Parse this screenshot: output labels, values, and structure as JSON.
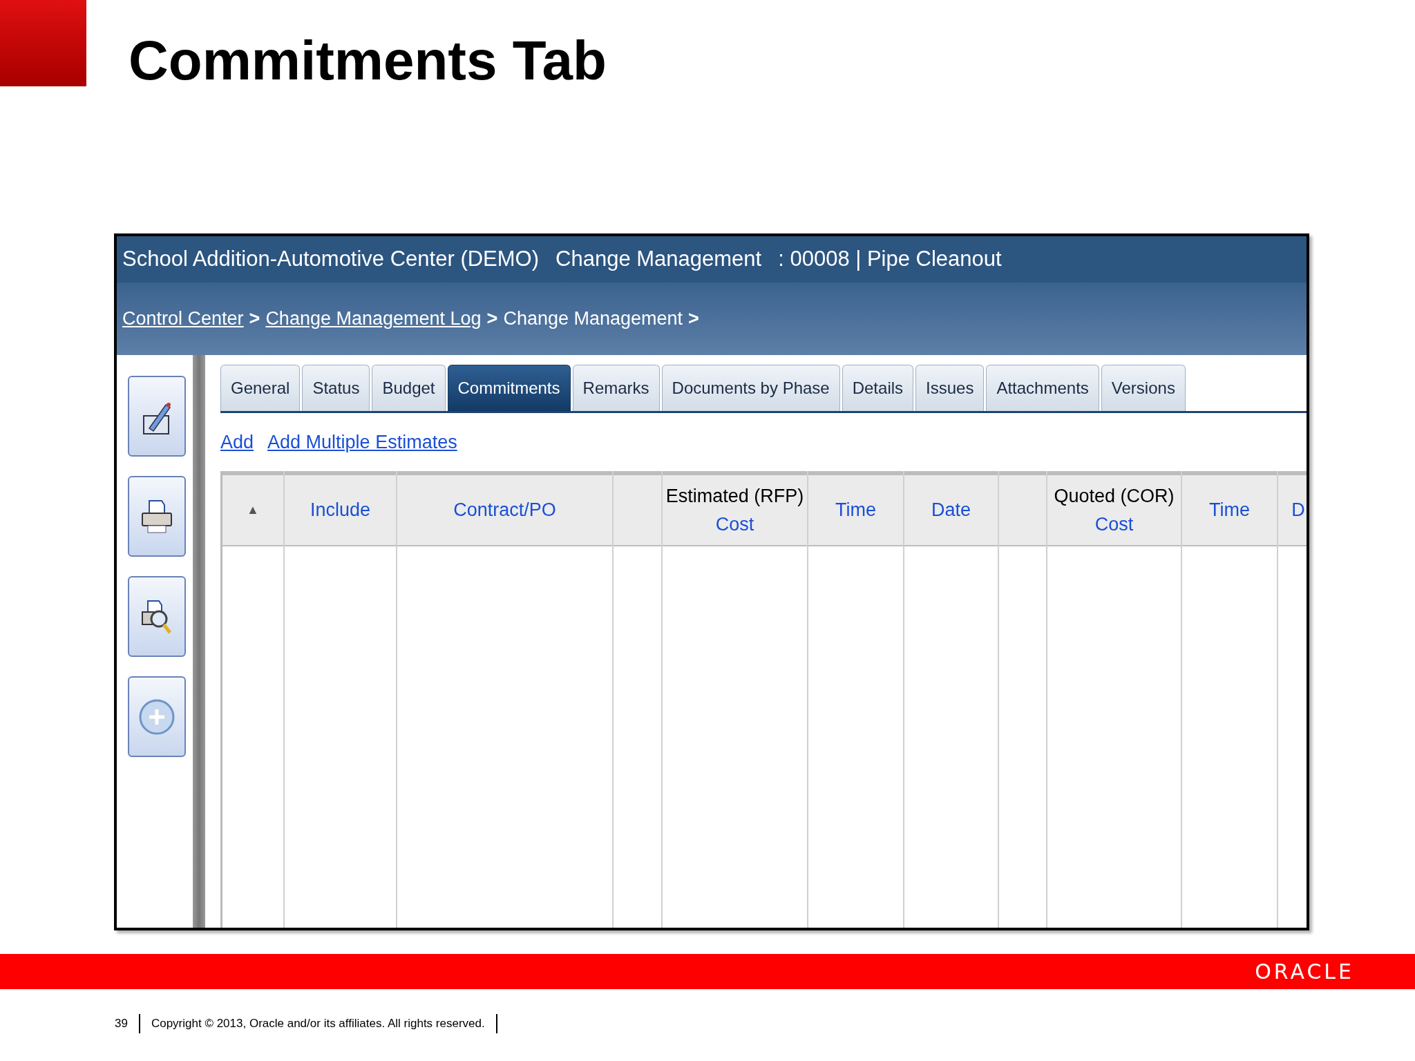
{
  "slide": {
    "title": "Commitments Tab",
    "page_number": "39",
    "copyright": "Copyright © 2013, Oracle and/or its affiliates. All rights reserved.",
    "logo": "ORACLE"
  },
  "window": {
    "title_parts": [
      "School Addition-Automotive Center (DEMO)",
      "Change Management",
      ": 00008 | Pipe Cleanout"
    ]
  },
  "breadcrumb": [
    {
      "label": "Control Center",
      "link": true,
      "separator": ">"
    },
    {
      "label": "Change Management Log",
      "link": true,
      "separator": ">"
    },
    {
      "label": "Change Management",
      "link": false,
      "separator": ">"
    }
  ],
  "toolbar": [
    {
      "kind": "edit"
    },
    {
      "kind": "print"
    },
    {
      "kind": "preview"
    },
    {
      "kind": "add"
    }
  ],
  "tabs": [
    {
      "label": "General",
      "selected": false
    },
    {
      "label": "Status",
      "selected": false
    },
    {
      "label": "Budget",
      "selected": false
    },
    {
      "label": "Commitments",
      "selected": true
    },
    {
      "label": "Remarks",
      "selected": false
    },
    {
      "label": "Documents by Phase",
      "selected": false
    },
    {
      "label": "Details",
      "selected": false
    },
    {
      "label": "Issues",
      "selected": false
    },
    {
      "label": "Attachments",
      "selected": false
    },
    {
      "label": "Versions",
      "selected": false
    }
  ],
  "actions": [
    "Add",
    "Add Multiple Estimates"
  ],
  "table": {
    "columns": [
      {
        "kind": "sort",
        "label": "▲"
      },
      {
        "kind": "link",
        "label": "Include"
      },
      {
        "kind": "link",
        "label": "Contract/PO"
      },
      {
        "kind": "empty"
      },
      {
        "kind": "group",
        "label": "Estimated (RFP)",
        "sublabel": "Cost"
      },
      {
        "kind": "link",
        "label": "Time"
      },
      {
        "kind": "link",
        "label": "Date"
      },
      {
        "kind": "empty"
      },
      {
        "kind": "group",
        "label": "Quoted (COR)",
        "sublabel": "Cost"
      },
      {
        "kind": "link",
        "label": "Time"
      },
      {
        "kind": "link",
        "label": "D"
      }
    ]
  }
}
